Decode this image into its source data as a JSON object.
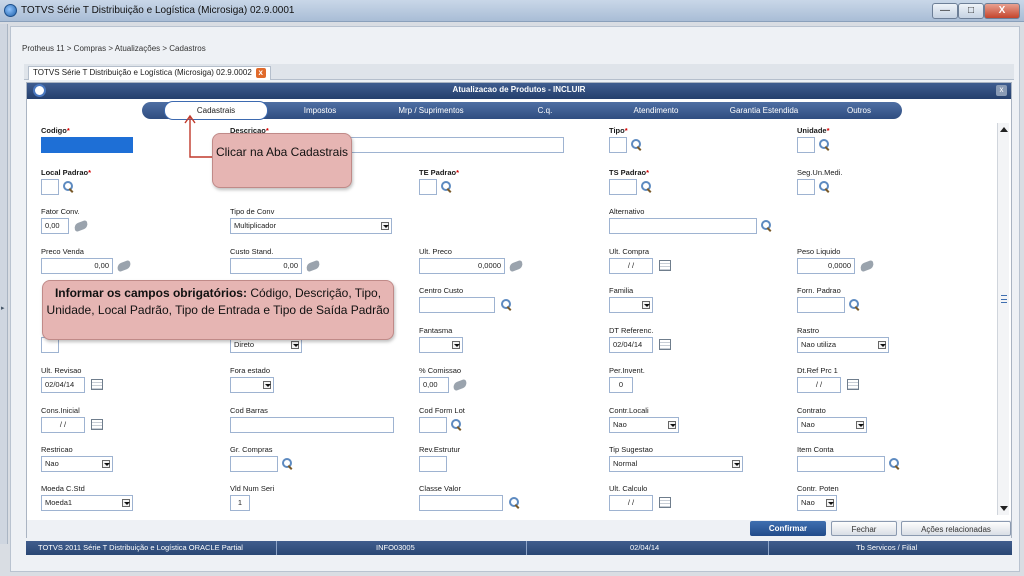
{
  "window": {
    "title": "TOTVS Série T Distribuição e Logística (Microsiga) 02.9.0001",
    "min": "—",
    "max": "□",
    "close": "X"
  },
  "breadcrumb": "Protheus 11 > Compras  > Atualizações > Cadastros",
  "open_tab": {
    "label": "TOTVS Série T Distribuição e Logística (Microsiga) 02.9.0002",
    "close": "x"
  },
  "dialog": {
    "title": "Atualizacao de Produtos - INCLUIR",
    "close": "x"
  },
  "tabs": [
    "Cadastrais",
    "Impostos",
    "Mrp / Suprimentos",
    "C.q.",
    "Atendimento",
    "Garantia Estendida",
    "Outros"
  ],
  "active_tab": "Cadastrais",
  "fields": {
    "codigo": {
      "label": "Codigo",
      "value": ""
    },
    "descricao": {
      "label": "Descricao",
      "value": ""
    },
    "tipo": {
      "label": "Tipo",
      "value": ""
    },
    "unidade": {
      "label": "Unidade",
      "value": ""
    },
    "local_padrao": {
      "label": "Local Padrao",
      "value": ""
    },
    "te_padrao": {
      "label": "TE Padrao",
      "value": ""
    },
    "ts_padrao": {
      "label": "TS Padrao",
      "value": ""
    },
    "seg_un_medi": {
      "label": "Seg.Un.Medi.",
      "value": ""
    },
    "fator_conv": {
      "label": "Fator Conv.",
      "value": "0,00"
    },
    "tipo_de_conv": {
      "label": "Tipo de Conv",
      "value": "Multiplicador"
    },
    "alternativo": {
      "label": "Alternativo",
      "value": ""
    },
    "preco_venda": {
      "label": "Preco Venda",
      "value": "0,00"
    },
    "custo_stand": {
      "label": "Custo Stand.",
      "value": "0,00"
    },
    "ult_preco": {
      "label": "Ult. Preco",
      "value": "0,0000"
    },
    "ult_compra": {
      "label": "Ult. Compra",
      "value": "/ /"
    },
    "peso_liquido": {
      "label": "Peso Liquido",
      "value": "0,0000"
    },
    "centro_custo": {
      "label": "Centro Custo",
      "value": ""
    },
    "familia": {
      "label": "Familia",
      "value": ""
    },
    "forn_padrao": {
      "label": "Forn. Padrao",
      "value": ""
    },
    "apropriacao": {
      "label": "",
      "value": "Direto"
    },
    "fantasma": {
      "label": "Fantasma",
      "value": ""
    },
    "dt_referenc": {
      "label": "DT Referenc.",
      "value": "02/04/14"
    },
    "rastro": {
      "label": "Rastro",
      "value": "Nao utiliza"
    },
    "ult_revisao": {
      "label": "Ult. Revisao",
      "value": "02/04/14"
    },
    "fora_estado": {
      "label": "Fora estado",
      "value": ""
    },
    "pct_comissao": {
      "label": "% Comissao",
      "value": "0,00"
    },
    "per_invent": {
      "label": "Per.Invent.",
      "value": "0"
    },
    "dt_ref_prc1": {
      "label": "Dt.Ref Prc 1",
      "value": "/ /"
    },
    "cons_inicial": {
      "label": "Cons.Inicial",
      "value": "/ /"
    },
    "cod_barras": {
      "label": "Cod Barras",
      "value": ""
    },
    "cod_form_lot": {
      "label": "Cod Form Lot",
      "value": ""
    },
    "contr_locali": {
      "label": "Contr.Locali",
      "value": "Nao"
    },
    "contrato": {
      "label": "Contrato",
      "value": "Nao"
    },
    "restricao": {
      "label": "Restricao",
      "value": "Nao"
    },
    "gr_compras": {
      "label": "Gr. Compras",
      "value": ""
    },
    "rev_estrutur": {
      "label": "Rev.Estrutur",
      "value": ""
    },
    "tip_sugestao": {
      "label": "Tip Sugestao",
      "value": "Normal"
    },
    "item_conta": {
      "label": "Item Conta",
      "value": ""
    },
    "moeda_c_std": {
      "label": "Moeda C.Std",
      "value": "Moeda1"
    },
    "vld_num_seri": {
      "label": "Vld Num Seri",
      "value": "1"
    },
    "classe_valor": {
      "label": "Classe Valor",
      "value": ""
    },
    "ult_calculo": {
      "label": "Ult. Calculo",
      "value": "/ /"
    },
    "contr_poten": {
      "label": "Contr. Poten",
      "value": "Nao"
    }
  },
  "buttons": {
    "confirm": "Confirmar",
    "close": "Fechar",
    "actions": "Ações relacionadas"
  },
  "status": {
    "product": "TOTVS 2011 Série T Distribuição e Logística ORACLE Partial",
    "env": "INFO03005",
    "date": "02/04/14",
    "branch": "Tb Servicos / Filial"
  },
  "callouts": {
    "tab": "Clicar na Aba Cadastrais",
    "fields_bold": "Informar os campos obrigatórios:",
    "fields_text": "Código, Descrição, Tipo, Unidade, Local Padrão, Tipo de Entrada e Tipo de Saída Padrão"
  },
  "colors": {
    "accent": "#2f4d80",
    "required": "#d40000",
    "callout": "#e6b5b3"
  }
}
